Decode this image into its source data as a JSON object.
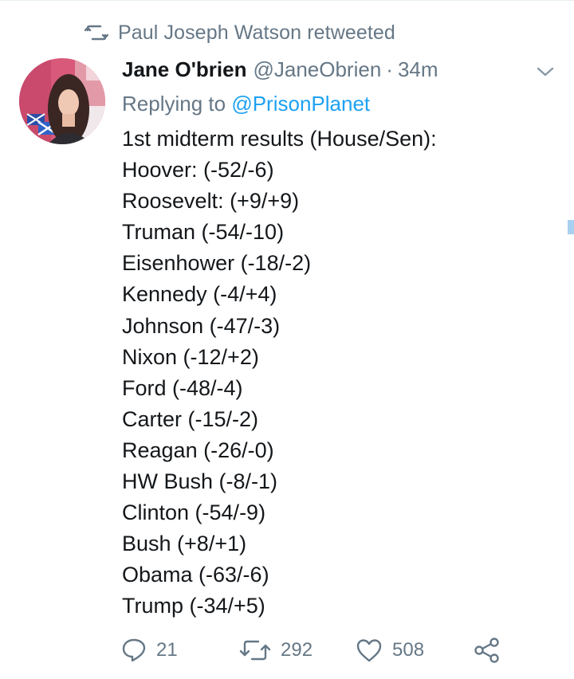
{
  "retweet_context": {
    "icon": "retweet-icon",
    "text": "Paul Joseph Watson retweeted"
  },
  "tweet": {
    "author_name": "Jane O'brien",
    "handle": "@JaneObrien",
    "separator": "·",
    "time": "34m",
    "reply_prefix": "Replying to",
    "reply_mention": "@PrisonPlanet",
    "text_lines": [
      "1st midterm results (House/Sen):",
      "Hoover: (-52/-6)",
      "Roosevelt: (+9/+9)",
      "Truman (-54/-10)",
      "Eisenhower (-18/-2)",
      "Kennedy (-4/+4)",
      "Johnson (-47/-3)",
      "Nixon (-12/+2)",
      "Ford (-48/-4)",
      "Carter (-15/-2)",
      "Reagan (-26/-0)",
      "HW Bush (-8/-1)",
      "Clinton (-54/-9)",
      "Bush (+8/+1)",
      "Obama (-63/-6)",
      "Trump (-34/+5)"
    ]
  },
  "actions": {
    "reply_count": "21",
    "retweet_count": "292",
    "like_count": "508"
  },
  "colors": {
    "text": "#14171a",
    "secondary": "#657786",
    "link": "#1da1f2"
  },
  "icons": [
    "retweet-icon",
    "chevron-down-icon",
    "reply-icon",
    "like-icon",
    "share-icon"
  ]
}
